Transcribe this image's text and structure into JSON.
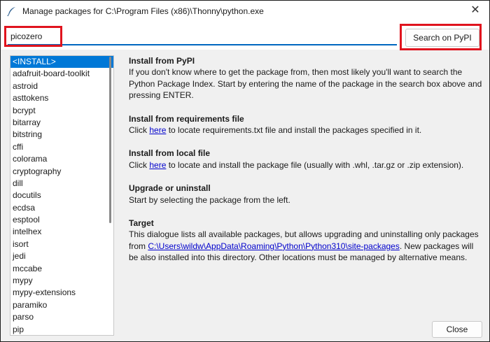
{
  "window": {
    "title": "Manage packages for C:\\Program Files (x86)\\Thonny\\python.exe"
  },
  "search": {
    "value": "picozero",
    "button_label": "Search on PyPI"
  },
  "packages": [
    "<INSTALL>",
    "adafruit-board-toolkit",
    "astroid",
    "asttokens",
    "bcrypt",
    "bitarray",
    "bitstring",
    "cffi",
    "colorama",
    "cryptography",
    "dill",
    "docutils",
    "ecdsa",
    "esptool",
    "intelhex",
    "isort",
    "jedi",
    "mccabe",
    "mypy",
    "mypy-extensions",
    "paramiko",
    "parso",
    "pip"
  ],
  "selected_index": 0,
  "info": {
    "pypi_heading": "Install from PyPI",
    "pypi_text": "If you don't know where to get the package from, then most likely you'll want to search the Python Package Index. Start by entering the name of the package in the search box above and pressing ENTER.",
    "req_heading": "Install from requirements file",
    "req_pre": "Click ",
    "req_link": "here",
    "req_post": " to locate requirements.txt file and install the packages specified in it.",
    "local_heading": "Install from local file",
    "local_pre": "Click ",
    "local_link": "here",
    "local_post": " to locate and install the package file (usually with .whl, .tar.gz or .zip extension).",
    "upgrade_heading": "Upgrade or uninstall",
    "upgrade_text": "Start by selecting the package from the left.",
    "target_heading": "Target",
    "target_pre": "This dialogue lists all available packages, but allows upgrading and uninstalling only packages from ",
    "target_link": "C:\\Users\\wildw\\AppData\\Roaming\\Python\\Python310\\site-packages",
    "target_post": ". New packages will be also installed into this directory. Other locations must be managed by alternative means."
  },
  "close_label": "Close",
  "close_glyph": "✕",
  "colors": {
    "selection": "#0078d7",
    "highlight_box": "#e0141e",
    "link": "#0000cc",
    "input_underline": "#0067c0"
  }
}
